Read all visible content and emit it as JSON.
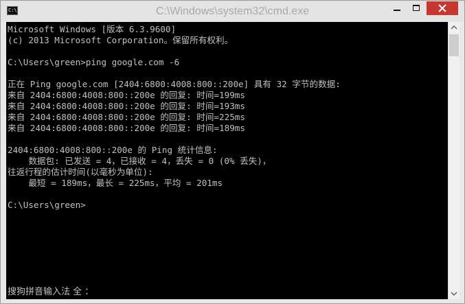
{
  "window": {
    "title": "C:\\Windows\\system32\\cmd.exe",
    "icon_label": "C:\\",
    "icons": {
      "app": "console-icon",
      "minimize": "minimize-icon",
      "maximize": "maximize-icon",
      "close": "close-icon",
      "scroll_up": "chevron-up-icon",
      "scroll_down": "chevron-down-icon"
    },
    "close_color": "#c7372f"
  },
  "console": {
    "lines": [
      "Microsoft Windows [版本 6.3.9600]",
      "(c) 2013 Microsoft Corporation。保留所有权利。",
      "",
      "C:\\Users\\green>ping google.com -6",
      "",
      "正在 Ping google.com [2404:6800:4008:800::200e] 具有 32 字节的数据:",
      "来自 2404:6800:4008:800::200e 的回复: 时间=199ms",
      "来自 2404:6800:4008:800::200e 的回复: 时间=193ms",
      "来自 2404:6800:4008:800::200e 的回复: 时间=225ms",
      "来自 2404:6800:4008:800::200e 的回复: 时间=189ms",
      "",
      "2404:6800:4008:800::200e 的 Ping 统计信息:",
      "    数据包: 已发送 = 4，已接收 = 4，丢失 = 0 (0% 丢失)，",
      "往返行程的估计时间(以毫秒为单位):",
      "    最短 = 189ms，最长 = 225ms，平均 = 201ms",
      "",
      "C:\\Users\\green>"
    ],
    "ime_status": "搜狗拼音输入法 全 ："
  }
}
